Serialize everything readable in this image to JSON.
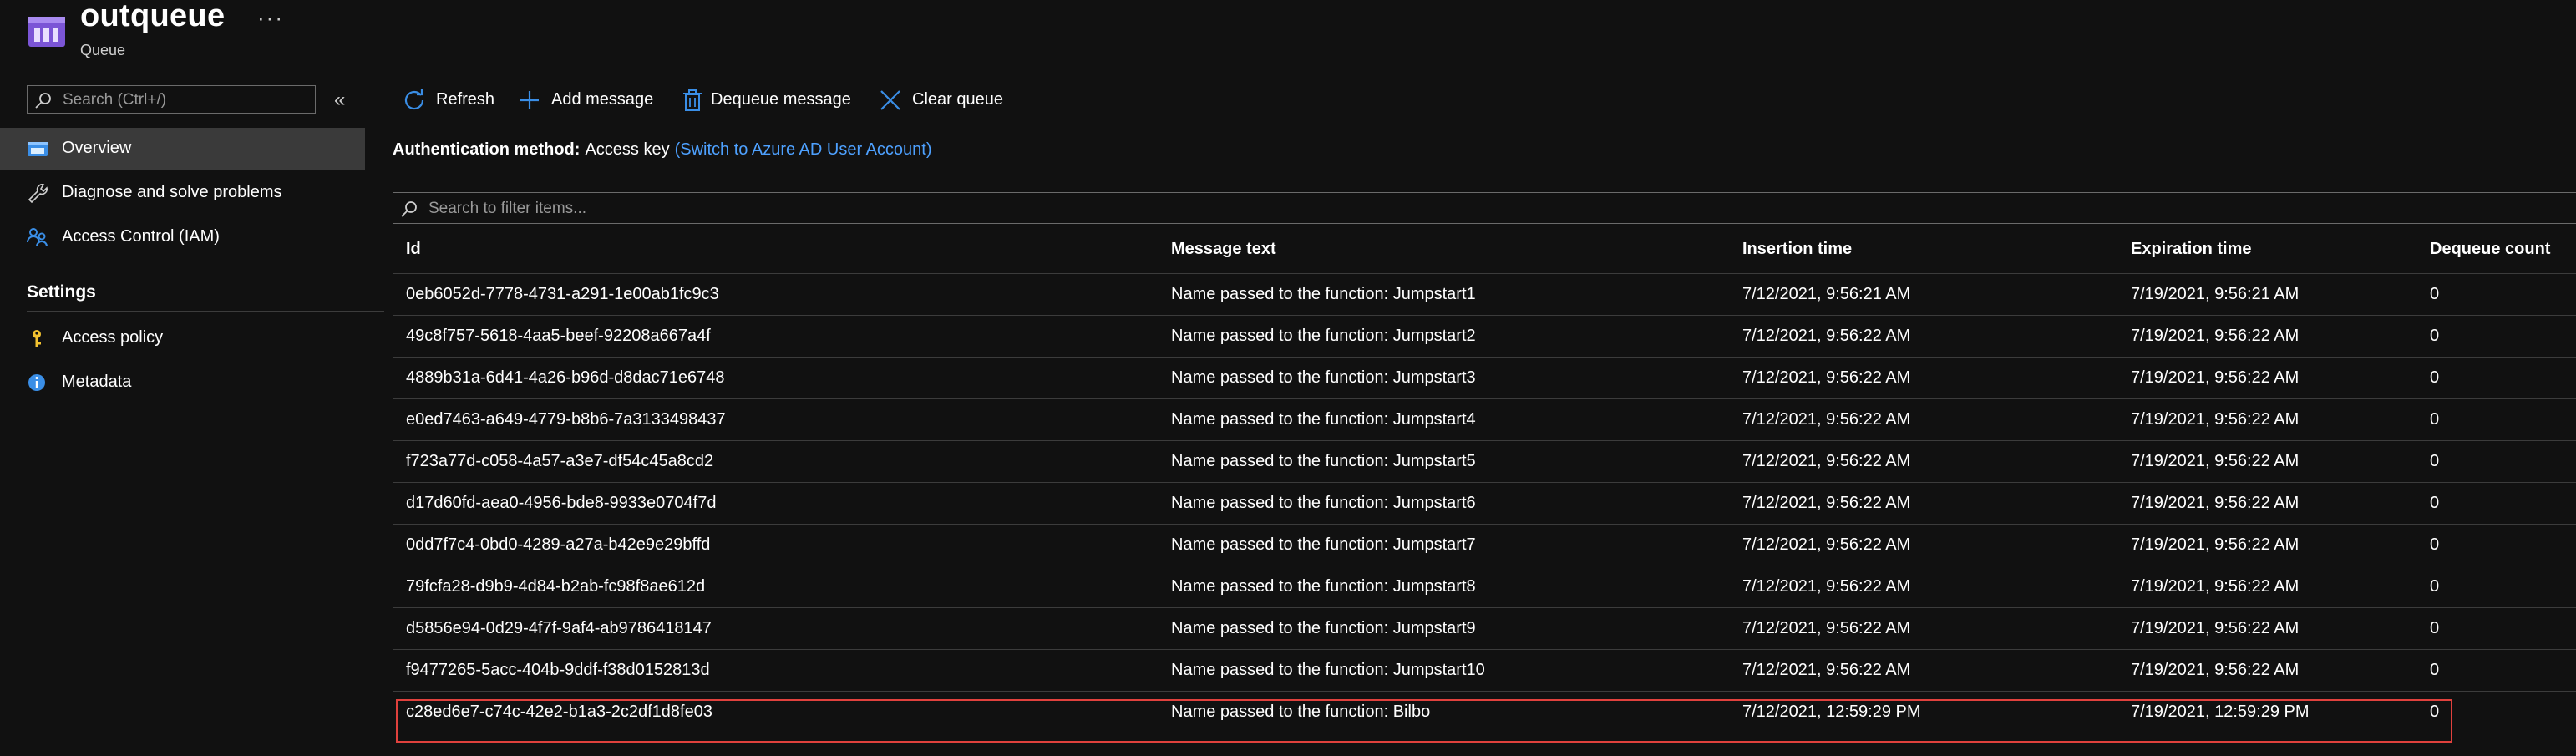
{
  "header": {
    "title": "outqueue",
    "subtitle": "Queue",
    "more": "···"
  },
  "sidebar": {
    "search_placeholder": "Search (Ctrl+/)",
    "collapse": "«",
    "items": [
      {
        "label": "Overview",
        "icon": "queue-overview-icon"
      },
      {
        "label": "Diagnose and solve problems",
        "icon": "wrench-icon"
      },
      {
        "label": "Access Control (IAM)",
        "icon": "people-icon"
      }
    ],
    "settings_title": "Settings",
    "settings_items": [
      {
        "label": "Access policy",
        "icon": "key-icon"
      },
      {
        "label": "Metadata",
        "icon": "info-icon"
      }
    ]
  },
  "toolbar": {
    "refresh": "Refresh",
    "add_message": "Add message",
    "dequeue_message": "Dequeue message",
    "clear_queue": "Clear queue"
  },
  "auth": {
    "label": "Authentication method:",
    "value": "Access key",
    "link": "(Switch to Azure AD User Account)"
  },
  "filter": {
    "placeholder": "Search to filter items..."
  },
  "table": {
    "headers": {
      "id": "Id",
      "message": "Message text",
      "insertion": "Insertion time",
      "expiration": "Expiration time",
      "dequeue": "Dequeue count"
    },
    "rows": [
      [
        "0eb6052d-7778-4731-a291-1e00ab1fc9c3",
        "Name passed to the function: Jumpstart1",
        "7/12/2021, 9:56:21 AM",
        "7/19/2021, 9:56:21 AM",
        "0"
      ],
      [
        "49c8f757-5618-4aa5-beef-92208a667a4f",
        "Name passed to the function: Jumpstart2",
        "7/12/2021, 9:56:22 AM",
        "7/19/2021, 9:56:22 AM",
        "0"
      ],
      [
        "4889b31a-6d41-4a26-b96d-d8dac71e6748",
        "Name passed to the function: Jumpstart3",
        "7/12/2021, 9:56:22 AM",
        "7/19/2021, 9:56:22 AM",
        "0"
      ],
      [
        "e0ed7463-a649-4779-b8b6-7a3133498437",
        "Name passed to the function: Jumpstart4",
        "7/12/2021, 9:56:22 AM",
        "7/19/2021, 9:56:22 AM",
        "0"
      ],
      [
        "f723a77d-c058-4a57-a3e7-df54c45a8cd2",
        "Name passed to the function: Jumpstart5",
        "7/12/2021, 9:56:22 AM",
        "7/19/2021, 9:56:22 AM",
        "0"
      ],
      [
        "d17d60fd-aea0-4956-bde8-9933e0704f7d",
        "Name passed to the function: Jumpstart6",
        "7/12/2021, 9:56:22 AM",
        "7/19/2021, 9:56:22 AM",
        "0"
      ],
      [
        "0dd7f7c4-0bd0-4289-a27a-b42e9e29bffd",
        "Name passed to the function: Jumpstart7",
        "7/12/2021, 9:56:22 AM",
        "7/19/2021, 9:56:22 AM",
        "0"
      ],
      [
        "79fcfa28-d9b9-4d84-b2ab-fc98f8ae612d",
        "Name passed to the function: Jumpstart8",
        "7/12/2021, 9:56:22 AM",
        "7/19/2021, 9:56:22 AM",
        "0"
      ],
      [
        "d5856e94-0d29-4f7f-9af4-ab9786418147",
        "Name passed to the function: Jumpstart9",
        "7/12/2021, 9:56:22 AM",
        "7/19/2021, 9:56:22 AM",
        "0"
      ],
      [
        "f9477265-5acc-404b-9ddf-f38d0152813d",
        "Name passed to the function: Jumpstart10",
        "7/12/2021, 9:56:22 AM",
        "7/19/2021, 9:56:22 AM",
        "0"
      ],
      [
        "c28ed6e7-c74c-42e2-b1a3-2c2df1d8fe03",
        "Name passed to the function: Bilbo",
        "7/12/2021, 12:59:29 PM",
        "7/19/2021, 12:59:29 PM",
        "0"
      ]
    ]
  },
  "colors": {
    "background": "#111111",
    "accent": "#4ea1ff",
    "active_nav": "#3a3a3a",
    "highlight_border": "#e0413d"
  }
}
